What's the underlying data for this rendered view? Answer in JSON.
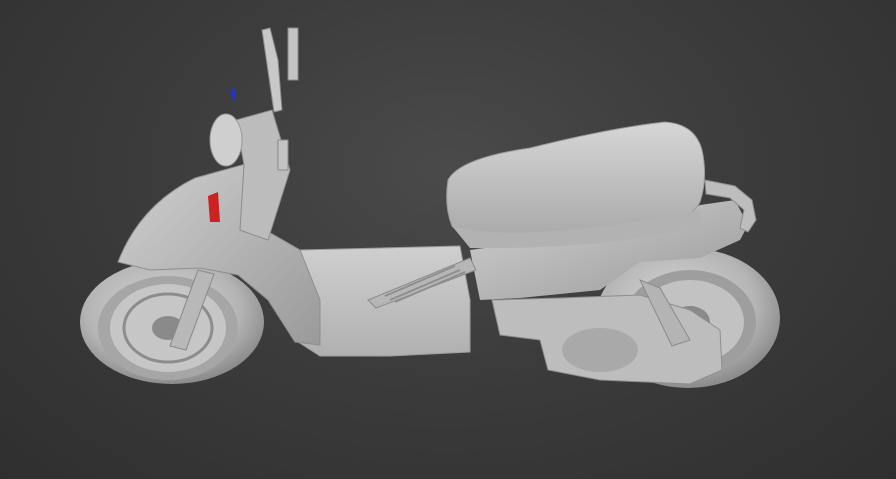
{
  "viewport": {
    "background_color": "#3d3d3d",
    "model_color": "#c8c8c8",
    "accent_colors": {
      "red": "#cc2222",
      "blue": "#2233cc"
    }
  }
}
